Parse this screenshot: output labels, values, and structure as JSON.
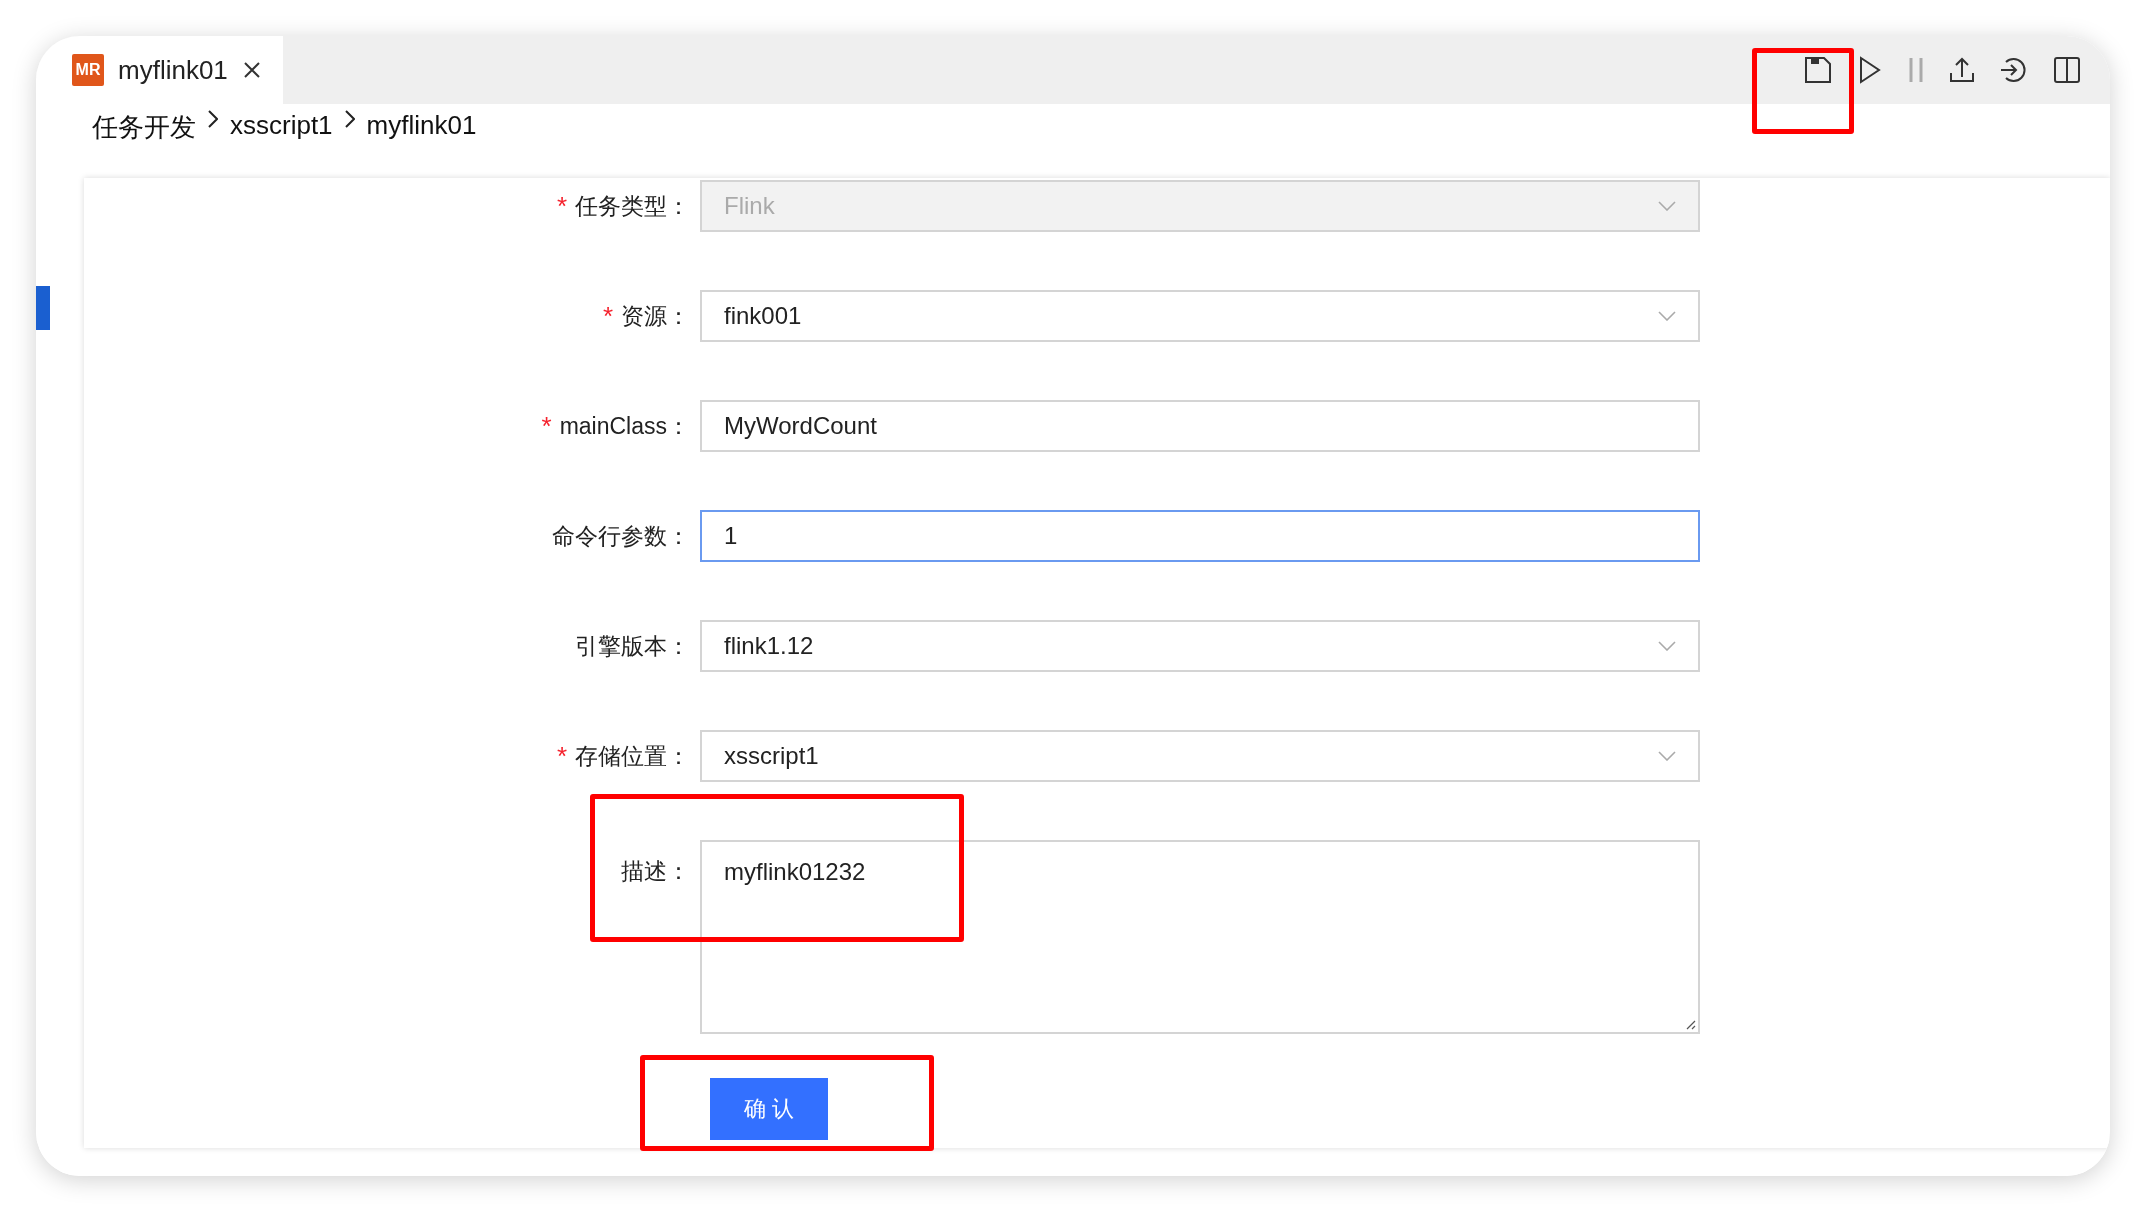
{
  "tab": {
    "badge": "MR",
    "title": "myflink01",
    "selected": true
  },
  "toolbar": [
    {
      "kind": "save",
      "disabled": false
    },
    {
      "kind": "run",
      "disabled": false
    },
    {
      "kind": "pause",
      "disabled": true
    },
    {
      "kind": "upload",
      "disabled": false
    },
    {
      "kind": "login",
      "disabled": false
    },
    {
      "kind": "split",
      "disabled": false
    }
  ],
  "breadcrumb": [
    "任务开发",
    "xsscript1",
    "myflink01"
  ],
  "form": [
    {
      "label": "任务类型：",
      "required": true,
      "kind": "select",
      "value": "Flink",
      "disabled": true,
      "focused": false
    },
    {
      "label": "资源：",
      "required": true,
      "kind": "select",
      "value": "fink001",
      "disabled": false,
      "focused": false
    },
    {
      "label": "mainClass：",
      "required": true,
      "kind": "input",
      "value": "MyWordCount",
      "disabled": false,
      "focused": false
    },
    {
      "label": "命令行参数：",
      "required": false,
      "kind": "input",
      "value": "1",
      "disabled": false,
      "focused": true
    },
    {
      "label": "引擎版本：",
      "required": false,
      "kind": "select",
      "value": "flink1.12",
      "disabled": false,
      "focused": false
    },
    {
      "label": "存储位置：",
      "required": true,
      "kind": "select",
      "value": "xsscript1",
      "disabled": false,
      "focused": false
    },
    {
      "label": "描述：",
      "required": false,
      "kind": "textarea",
      "value": "myflink01232",
      "disabled": false,
      "focused": false
    }
  ],
  "required_mark": "*",
  "submit": "确 认"
}
